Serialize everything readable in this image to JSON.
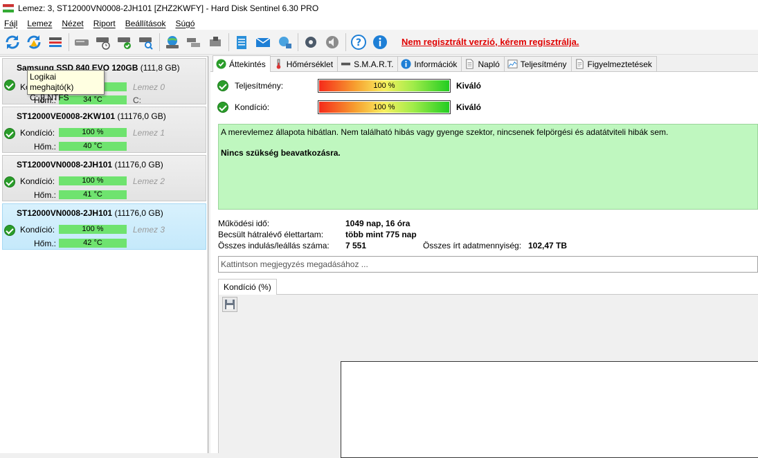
{
  "window": {
    "title": "Lemez: 3, ST12000VN0008-2JH101 [ZHZ2KWFY]  -  Hard Disk Sentinel 6.30 PRO"
  },
  "menu": [
    "Fájl",
    "Lemez",
    "Nézet",
    "Riport",
    "Beállítások",
    "Súgó"
  ],
  "toolbar": {
    "registration_notice": "Nem regisztrált verzió, kérem regisztrálja."
  },
  "disks": [
    {
      "model": "Samsung SSD 840 EVO 120GB",
      "size": "(111,8 GB)",
      "condition_label": "Kondíció:",
      "condition": "100 %",
      "temp_label": "Hőm.:",
      "temp": "34 °C",
      "disk_label": "Lemez 0",
      "drive": "C:"
    },
    {
      "model": "ST12000VE0008-2KW101",
      "size": "(11176,0 GB)",
      "condition_label": "Kondíció:",
      "condition": "100 %",
      "temp_label": "Hőm.:",
      "temp": "40 °C",
      "disk_label": "Lemez 1"
    },
    {
      "model": "ST12000VN0008-2JH101",
      "size": "(11176,0 GB)",
      "condition_label": "Kondíció:",
      "condition": "100 %",
      "temp_label": "Hőm.:",
      "temp": "41 °C",
      "disk_label": "Lemez 2"
    },
    {
      "model": "ST12000VN0008-2JH101",
      "size": "(11176,0 GB)",
      "condition_label": "Kondíció:",
      "condition": "100 %",
      "temp_label": "Hőm.:",
      "temp": "42 °C",
      "disk_label": "Lemez 3"
    }
  ],
  "tooltip": {
    "line1": "Logikai meghajtó(k)",
    "line2": "C: [] NTFS"
  },
  "tabs": [
    "Áttekintés",
    "Hőmérséklet",
    "S.M.A.R.T.",
    "Információk",
    "Napló",
    "Teljesítmény",
    "Figyelmeztetések"
  ],
  "overview": {
    "performance_label": "Teljesítmény:",
    "performance_value": "100 %",
    "performance_percent": 100,
    "performance_rating": "Kiváló",
    "condition_label": "Kondíció:",
    "condition_value": "100 %",
    "condition_percent": 100,
    "condition_rating": "Kiváló",
    "status_text": "A merevlemez állapota hibátlan. Nem található hibás vagy gyenge szektor, nincsenek felpörgési és adatátviteli hibák sem.",
    "status_action": "Nincs szükség beavatkozásra.",
    "power_on_label": "Működési idő:",
    "power_on_value": "1049 nap, 16 óra",
    "remaining_label": "Becsült hátralévő élettartam:",
    "remaining_value": "több mint 775 nap",
    "start_stop_label": "Összes indulás/leállás száma:",
    "start_stop_value": "7 551",
    "written_label": "Összes írt adatmennyiség:",
    "written_value": "102,47 TB",
    "note_placeholder": "Kattintson megjegyzés megadásához ...",
    "chart_tab": "Kondíció  (%)"
  }
}
